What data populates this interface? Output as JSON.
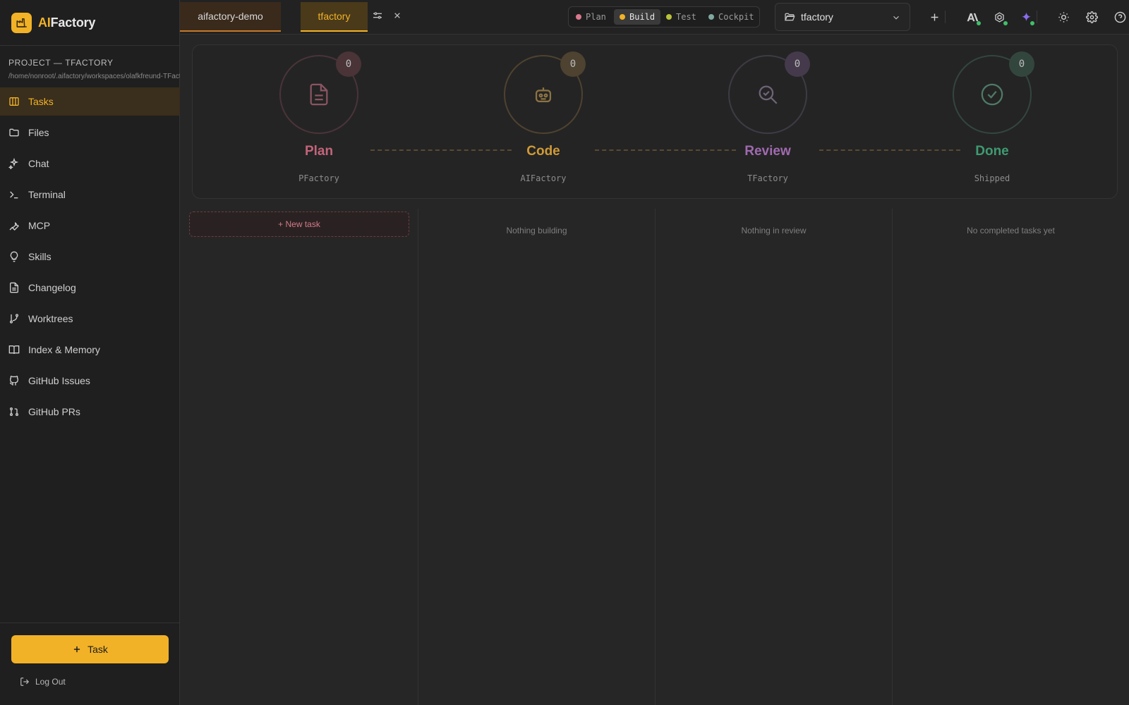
{
  "app": {
    "brand_prefix": "AI",
    "brand_suffix": "Factory"
  },
  "sidebar": {
    "project_title": "PROJECT — TFACTORY",
    "project_path": "/home/nonroot/.aifactory/workspaces/olafkfreund-TFactory",
    "items": [
      {
        "label": "Tasks",
        "icon": "kanban-icon",
        "active": true
      },
      {
        "label": "Files",
        "icon": "folder-icon"
      },
      {
        "label": "Chat",
        "icon": "sparkles-icon"
      },
      {
        "label": "Terminal",
        "icon": "terminal-icon"
      },
      {
        "label": "MCP",
        "icon": "wrench-icon"
      },
      {
        "label": "Skills",
        "icon": "lightbulb-icon"
      },
      {
        "label": "Changelog",
        "icon": "document-icon"
      },
      {
        "label": "Worktrees",
        "icon": "git-branch-icon"
      },
      {
        "label": "Index & Memory",
        "icon": "book-icon"
      },
      {
        "label": "GitHub Issues",
        "icon": "github-icon"
      },
      {
        "label": "GitHub PRs",
        "icon": "git-pull-request-icon"
      }
    ],
    "task_button": "Task",
    "logout": "Log Out"
  },
  "topbar": {
    "tabs": [
      {
        "label": "aifactory-demo"
      },
      {
        "label": "tfactory",
        "active": true
      }
    ],
    "modes": [
      {
        "label": "Plan",
        "color": "#d9788e"
      },
      {
        "label": "Build",
        "color": "#f2b227",
        "active": true
      },
      {
        "label": "Test",
        "color": "#b9c23a"
      },
      {
        "label": "Cockpit",
        "color": "#7fa8a0"
      }
    ],
    "project_select": "tfactory"
  },
  "pipeline": {
    "stages": [
      {
        "name": "Plan",
        "sub": "PFactory",
        "count": "0",
        "color": "#c2647a",
        "icon": "document-icon"
      },
      {
        "name": "Code",
        "sub": "AIFactory",
        "count": "0",
        "color": "#cf9a37",
        "icon": "robot-icon"
      },
      {
        "name": "Review",
        "sub": "TFactory",
        "count": "0",
        "color": "#a06ab0",
        "icon": "search-check-icon"
      },
      {
        "name": "Done",
        "sub": "Shipped",
        "count": "0",
        "color": "#3f9a72",
        "icon": "check-circle-icon"
      }
    ]
  },
  "board": {
    "new_task": "+ New task",
    "empty_build": "Nothing building",
    "empty_review": "Nothing in review",
    "empty_done": "No completed tasks yet"
  }
}
